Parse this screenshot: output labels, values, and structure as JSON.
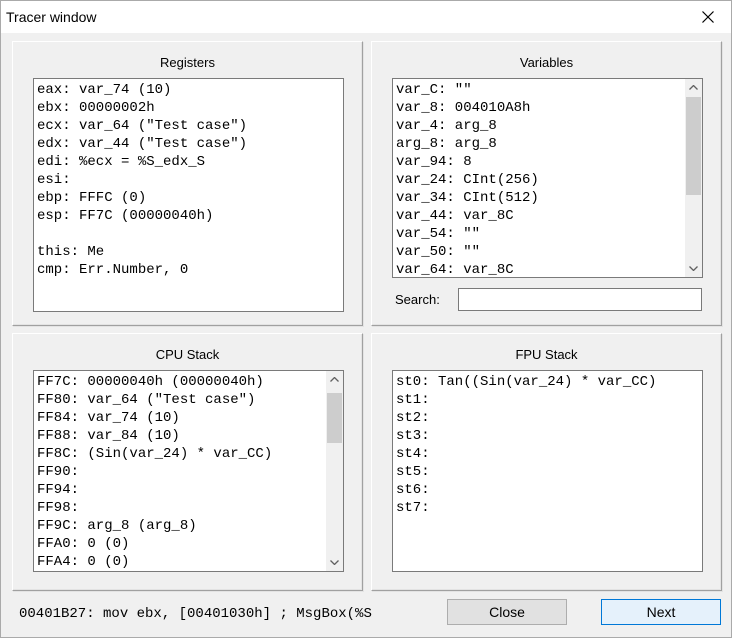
{
  "window": {
    "title": "Tracer window"
  },
  "registers": {
    "title": "Registers",
    "lines": [
      "eax: var_74 (10)",
      "ebx: 00000002h",
      "ecx: var_64 (\"Test case\")",
      "edx: var_44 (\"Test case\")",
      "edi: %ecx = %S_edx_S",
      "esi:",
      "ebp: FFFC (0)",
      "esp: FF7C (00000040h)",
      "",
      "this: Me",
      "cmp: Err.Number, 0"
    ]
  },
  "variables": {
    "title": "Variables",
    "lines": [
      "var_C: \"\"",
      "var_8: 004010A8h",
      "var_4: arg_8",
      "arg_8: arg_8",
      "var_94: 8",
      "var_24: CInt(256)",
      "var_34: CInt(512)",
      "var_44: var_8C",
      "var_54: \"\"",
      "var_50: \"\"",
      "var_64: var_8C"
    ],
    "search_label": "Search:",
    "search_value": ""
  },
  "cpu_stack": {
    "title": "CPU Stack",
    "lines": [
      "FF7C: 00000040h (00000040h)",
      "FF80: var_64 (\"Test case\")",
      "FF84: var_74 (10)",
      "FF88: var_84 (10)",
      "FF8C: (Sin(var_24) * var_CC)",
      "FF90:",
      "FF94:",
      "FF98:",
      "FF9C: arg_8 (arg_8)",
      "FFA0: 0 (0)",
      "FFA4: 0 (0)"
    ]
  },
  "fpu_stack": {
    "title": "FPU Stack",
    "lines": [
      "st0: Tan((Sin(var_24) * var_CC)",
      "st1:",
      "st2:",
      "st3:",
      "st4:",
      "st5:",
      "st6:",
      "st7:"
    ]
  },
  "status": {
    "instruction": "00401B27: mov ebx, [00401030h] ; MsgBox(%S"
  },
  "buttons": {
    "close": "Close",
    "next": "Next"
  },
  "icons": {
    "close": "close-icon",
    "scroll_up": "scroll-up-arrow-icon",
    "scroll_down": "scroll-down-arrow-icon"
  }
}
